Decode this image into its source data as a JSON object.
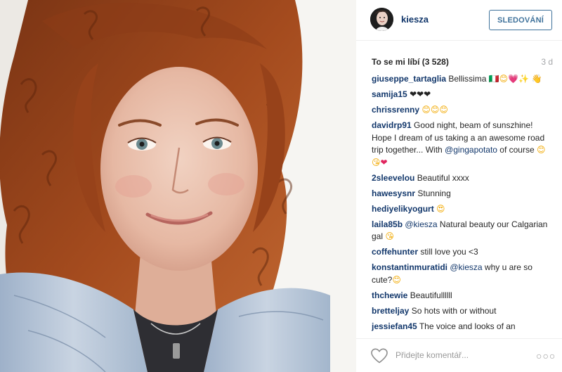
{
  "post": {
    "author": "kiesza",
    "follow_label": "SLEDOVÁNÍ",
    "likes_text": "To se mi líbí (3 528)",
    "time_ago": "3 d"
  },
  "comments": [
    {
      "user": "giuseppe_tartaglia",
      "parts": [
        {
          "t": "text",
          "v": " Bellissima "
        },
        {
          "t": "emoji",
          "v": "🇮🇹",
          "c": "em-smile"
        },
        {
          "t": "emoji",
          "v": "😊",
          "c": "em-smile"
        },
        {
          "t": "emoji",
          "v": "💗",
          "c": "em-heart"
        },
        {
          "t": "emoji",
          "v": "✨",
          "c": "em-smile"
        },
        {
          "t": "text",
          "v": " "
        },
        {
          "t": "emoji",
          "v": "👋",
          "c": "em-smile"
        }
      ]
    },
    {
      "user": "samija15",
      "parts": [
        {
          "t": "text",
          "v": " "
        },
        {
          "t": "emoji",
          "v": "❤❤❤",
          "c": "em-dark"
        }
      ]
    },
    {
      "user": "chrissrenny",
      "parts": [
        {
          "t": "text",
          "v": " "
        },
        {
          "t": "emoji",
          "v": "😊😊😊",
          "c": "em-smile"
        }
      ]
    },
    {
      "user": "davidrp91",
      "parts": [
        {
          "t": "text",
          "v": " Good night, beam of sunszhine! Hope I dream of us taking a an awesome road trip together... With "
        },
        {
          "t": "mention",
          "v": "@gingapotato"
        },
        {
          "t": "text",
          "v": " of course "
        },
        {
          "t": "emoji",
          "v": "😊😘",
          "c": "em-smile"
        },
        {
          "t": "emoji",
          "v": "❤",
          "c": "em-heart"
        }
      ]
    },
    {
      "user": "2sleevelou",
      "parts": [
        {
          "t": "text",
          "v": " Beautiful xxxx"
        }
      ]
    },
    {
      "user": "hawesysnr",
      "parts": [
        {
          "t": "text",
          "v": " Stunning"
        }
      ]
    },
    {
      "user": "hediyelikyogurt",
      "parts": [
        {
          "t": "text",
          "v": " "
        },
        {
          "t": "emoji",
          "v": "😍",
          "c": "em-smile"
        }
      ]
    },
    {
      "user": "laila85b",
      "parts": [
        {
          "t": "text",
          "v": " "
        },
        {
          "t": "mention",
          "v": "@kiesza"
        },
        {
          "t": "text",
          "v": " Natural beauty our Calgarian gal "
        },
        {
          "t": "emoji",
          "v": "😘",
          "c": "em-smile"
        }
      ]
    },
    {
      "user": "coffehunter",
      "parts": [
        {
          "t": "text",
          "v": " still love you <3"
        }
      ]
    },
    {
      "user": "konstantinmuratidi",
      "parts": [
        {
          "t": "text",
          "v": " "
        },
        {
          "t": "mention",
          "v": "@kiesza"
        },
        {
          "t": "text",
          "v": " why u are so cute?"
        },
        {
          "t": "emoji",
          "v": "😊",
          "c": "em-smile"
        }
      ]
    },
    {
      "user": "thchewie",
      "parts": [
        {
          "t": "text",
          "v": " Beautifullllll"
        }
      ]
    },
    {
      "user": "bretteljay",
      "parts": [
        {
          "t": "text",
          "v": " So hots with or without"
        }
      ]
    },
    {
      "user": "jessiefan45",
      "parts": [
        {
          "t": "text",
          "v": " The voice and looks of an"
        }
      ]
    }
  ],
  "footer": {
    "comment_placeholder": "Přidejte komentář...",
    "more_label": "○○○",
    "heart_icon": "heart-outline-icon"
  },
  "colors": {
    "username": "#12376b",
    "follow": "#3f729b",
    "muted": "#a5a7aa"
  }
}
